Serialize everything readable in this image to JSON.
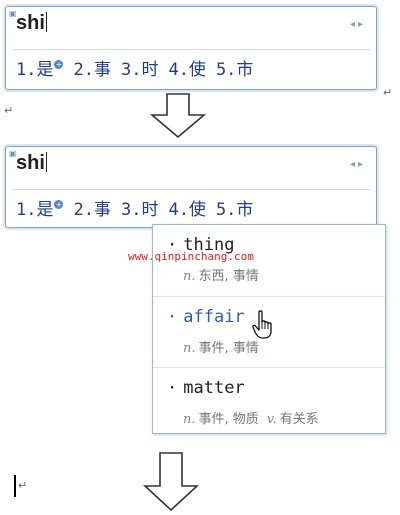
{
  "ime_top": {
    "composition": "shi",
    "nav": "◂▸",
    "candidates": [
      "1.是",
      "2.事",
      "3.时",
      "4.使",
      "5.市"
    ]
  },
  "ime_bottom": {
    "composition": "shi",
    "nav": "◂▸",
    "candidates": [
      "1.是",
      "2.事",
      "3.时",
      "4.使",
      "5.市"
    ]
  },
  "dictionary": [
    {
      "word": "thing",
      "defs": [
        {
          "pos": "n.",
          "text": "东西, 事情"
        }
      ]
    },
    {
      "word": "affair",
      "defs": [
        {
          "pos": "n.",
          "text": "事件, 事情"
        }
      ]
    },
    {
      "word": "matter",
      "defs": [
        {
          "pos": "n.",
          "text": "事件, 物质"
        },
        {
          "pos": "v.",
          "text": "有关系"
        }
      ]
    }
  ],
  "watermark": "www.qinpinchang.com",
  "colors": {
    "border": "#7fa2c8",
    "candidate": "#1f3f8a",
    "active_word": "#2d5fa6",
    "watermark": "#e02020"
  },
  "icons": [
    "plus-badge-icon",
    "down-arrow-icon",
    "hand-cursor-icon",
    "paragraph-mark-icon"
  ]
}
